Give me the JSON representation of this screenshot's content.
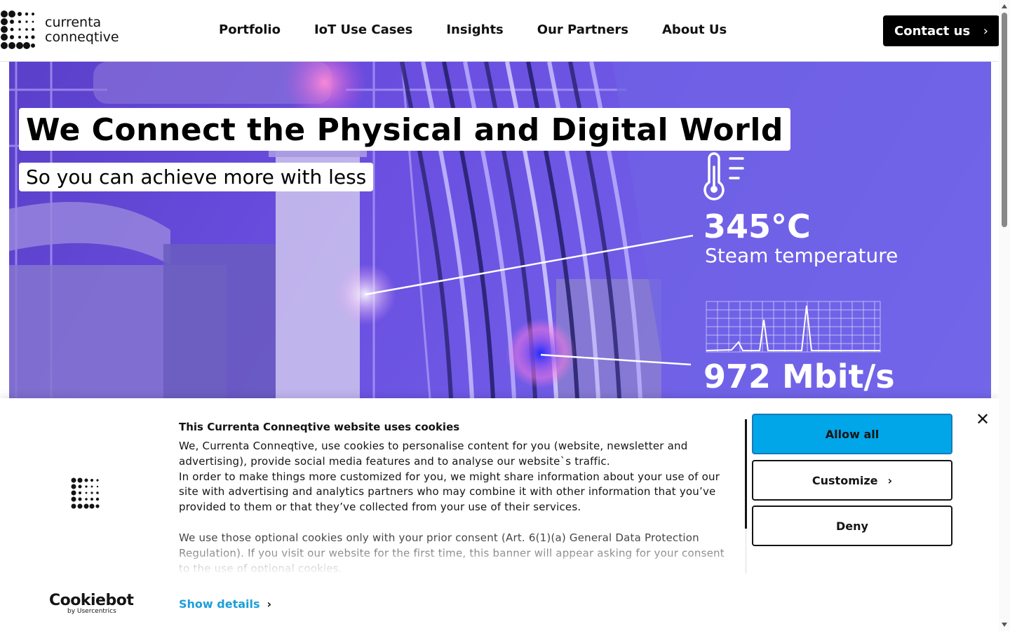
{
  "header": {
    "logo_line1": "currenta",
    "logo_line2": "conneqtive",
    "nav": [
      {
        "label": "Portfolio"
      },
      {
        "label": "IoT Use Cases"
      },
      {
        "label": "Insights"
      },
      {
        "label": "Our Partners"
      },
      {
        "label": "About Us"
      }
    ],
    "contact_label": "Contact us",
    "contact_icon": "chevron-right-icon"
  },
  "hero": {
    "headline": "We Connect the Physical and Digital World",
    "subline": "So you can achieve more with less",
    "temp_value": "345°C",
    "temp_label": "Steam temperature",
    "temp_icon": "thermometer-icon",
    "speed_value": "972 Mbit/s",
    "speed_icon": "signal-chart-icon",
    "accent_color": "#6a4ee0"
  },
  "cookie": {
    "title": "This Currenta Conneqtive website uses cookies",
    "paragraph1": "We, Currenta Conneqtive, use cookies to personalise content for you (website, newsletter and advertising), provide social media features and to analyse our website`s traffic.",
    "paragraph2": "In order to make things more customized for you, we might share information about your use of our site with advertising and analytics partners who may combine it with other information that you’ve provided to them or that they’ve collected from your use of their services.",
    "paragraph3": "We use those optional cookies only with your prior consent (Art. 6(1)(a) General Data Protection Regulation). If you visit our website for the first time, this banner will appear asking for your consent to the use of optional cookies.",
    "show_details": "Show details",
    "allow_all": "Allow all",
    "customize": "Customize",
    "deny": "Deny",
    "close_icon": "close-icon",
    "brand_name": "Cookiebot",
    "brand_sub": "by Usercentrics",
    "allow_color": "#00a6e8"
  }
}
